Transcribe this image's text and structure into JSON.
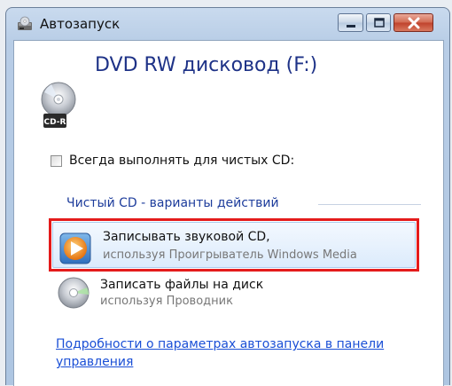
{
  "window": {
    "title": "Автозапуск"
  },
  "device": {
    "title": "DVD RW дисковод (F:)",
    "icon": "dvd-drive-icon",
    "badge": "CD-R"
  },
  "always": {
    "label": "Всегда выполнять для чистых CD:",
    "checked": false
  },
  "section": {
    "title": "Чистый CD - варианты действий"
  },
  "options": [
    {
      "title": "Записывать звуковой CD,",
      "subtitle": "используя Проигрыватель Windows Media",
      "icon": "windows-media-player-icon",
      "highlighted": true
    },
    {
      "title": "Записать файлы на диск",
      "subtitle": "используя Проводник",
      "icon": "disc-burn-icon",
      "highlighted": false
    }
  ],
  "footer": {
    "link": "Подробности о параметрах автозапуска в панели управления"
  },
  "colors": {
    "highlight_border": "#e41b1b",
    "title_blue": "#1e3287",
    "link_blue": "#1a4fd6"
  }
}
